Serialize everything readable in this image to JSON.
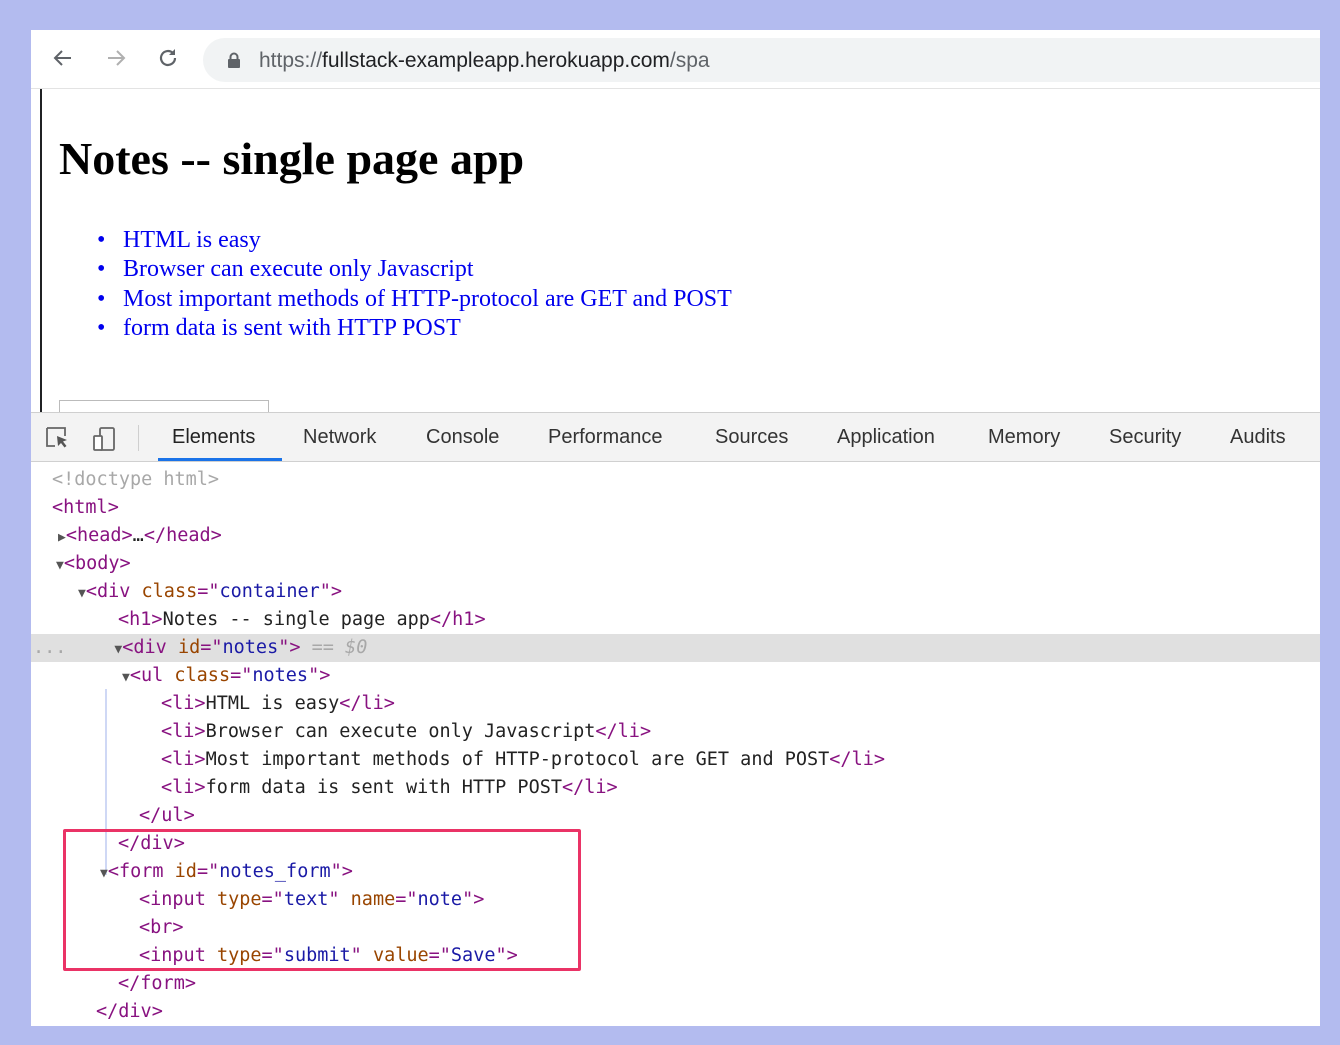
{
  "browser": {
    "url_scheme": "https://",
    "url_host": "fullstack-exampleapp.herokuapp.com",
    "url_path": "/spa"
  },
  "page": {
    "title": "Notes -- single page app",
    "notes": [
      "HTML is easy",
      "Browser can execute only Javascript",
      "Most important methods of HTTP-protocol are GET and POST",
      "form data is sent with HTTP POST"
    ],
    "note_input_value": ""
  },
  "devtools": {
    "tabs": [
      "Elements",
      "Network",
      "Console",
      "Performance",
      "Sources",
      "Application",
      "Memory",
      "Security",
      "Audits"
    ],
    "active_tab": "Elements",
    "selected_marker": "== $0",
    "ellipsis": "..."
  },
  "dom": {
    "doctype": "<!doctype html>",
    "html": "html",
    "head": "head",
    "head_ellipsis": "…",
    "body": "body",
    "div": "div",
    "class_attr": "class",
    "id_attr": "id",
    "container": "container",
    "h1": "h1",
    "h1_text": "Notes -- single page app",
    "notes_id": "notes",
    "ul": "ul",
    "notes_class": "notes",
    "li": "li",
    "li_texts": [
      "HTML is easy",
      "Browser can execute only Javascript",
      "Most important methods of HTTP-protocol are GET and POST",
      "form data is sent with HTTP POST"
    ],
    "form": "form",
    "form_id": "notes_form",
    "input": "input",
    "type_attr": "type",
    "name_attr": "name",
    "value_attr": "value",
    "text_type": "text",
    "note_name": "note",
    "br": "br",
    "submit_type": "submit",
    "save_value": "Save"
  },
  "colors": {
    "highlight": "#ea3366",
    "link": "#0000ee",
    "tag": "#881280",
    "attr": "#994500",
    "value": "#1a1aa6",
    "tab_underline": "#1a73e8",
    "frame_bg": "#b3bbef"
  }
}
